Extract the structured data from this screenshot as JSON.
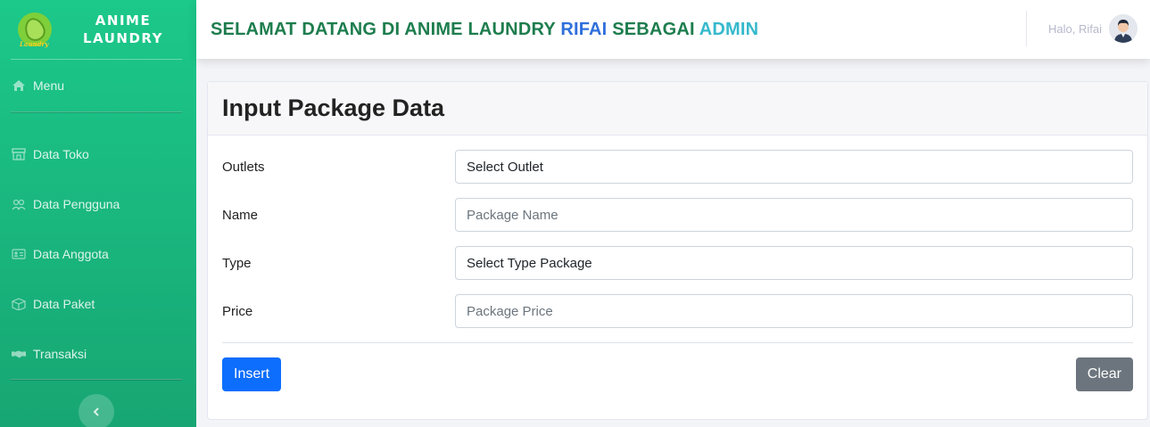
{
  "brand": {
    "line1": "ANIME",
    "line2": "LAUNDRY",
    "logo_tag": "Laundry"
  },
  "sidebar": {
    "menu_label": "Menu",
    "items": [
      {
        "label": "Data Toko",
        "icon": "store-icon"
      },
      {
        "label": "Data Pengguna",
        "icon": "users-icon"
      },
      {
        "label": "Data Anggota",
        "icon": "id-card-icon"
      },
      {
        "label": "Data Paket",
        "icon": "box-icon"
      },
      {
        "label": "Transaksi",
        "icon": "handshake-icon"
      }
    ],
    "toggle_icon": "chevron-left-icon"
  },
  "topbar": {
    "welcome_prefix": "SELAMAT DATANG DI ANIME LAUNDRY",
    "welcome_name": "RIFAI",
    "welcome_middle": "SEBAGAI",
    "welcome_role": "ADMIN",
    "greeting": "Halo, Rifai"
  },
  "form": {
    "title": "Input Package Data",
    "outlets_label": "Outlets",
    "outlets_value": "Select Outlet",
    "name_label": "Name",
    "name_placeholder": "Package Name",
    "type_label": "Type",
    "type_value": "Select Type Package",
    "price_label": "Price",
    "price_placeholder": "Package Price",
    "insert_label": "Insert",
    "clear_label": "Clear"
  },
  "colors": {
    "sidebar_start": "#1cc88a",
    "sidebar_end": "#17a673",
    "welcome_text": "#1e7d4e",
    "name_accent": "#2f6fdb",
    "role_accent": "#36b9cc",
    "primary": "#0d6efd",
    "secondary": "#6c757d"
  }
}
